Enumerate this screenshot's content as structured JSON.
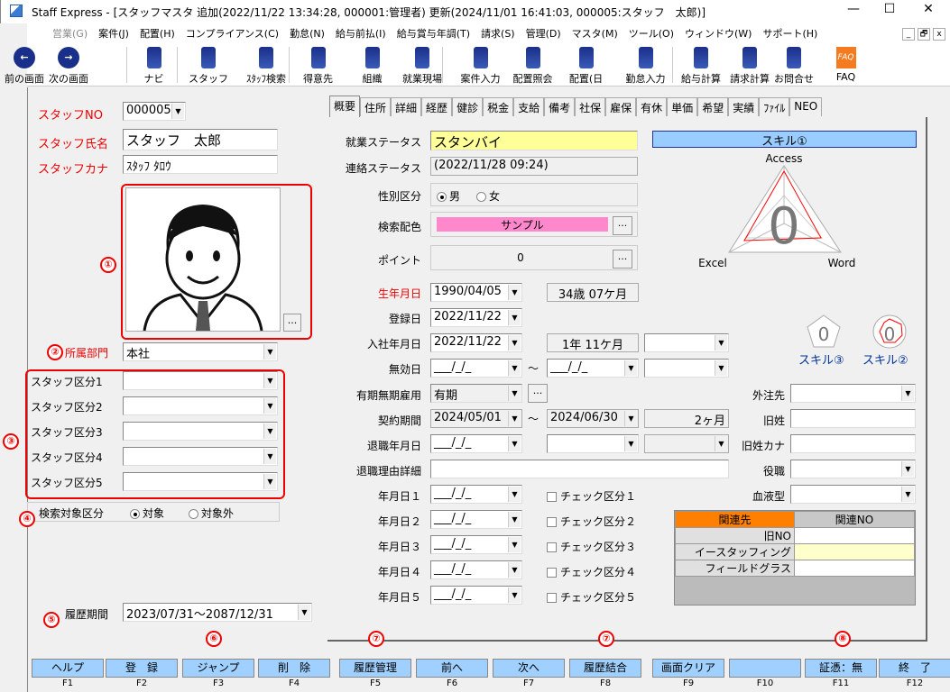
{
  "window": {
    "title": "Staff Express - [スタッフマスタ 追加(2022/11/22 13:34:28, 000001:管理者) 更新(2024/11/01 16:41:03, 000005:スタッフ　太郎)]",
    "minimize": "—",
    "maximize": "☐",
    "close": "✕"
  },
  "menu": [
    {
      "label": "営業(G)",
      "disabled": true
    },
    {
      "label": "案件(J)"
    },
    {
      "label": "配置(H)"
    },
    {
      "label": "コンプライアンス(C)"
    },
    {
      "label": "勤怠(N)"
    },
    {
      "label": "給与前払(I)"
    },
    {
      "label": "給与賞与年調(T)"
    },
    {
      "label": "請求(S)"
    },
    {
      "label": "管理(D)"
    },
    {
      "label": "マスタ(M)"
    },
    {
      "label": "ツール(O)"
    },
    {
      "label": "ウィンドウ(W)"
    },
    {
      "label": "サポート(H)"
    }
  ],
  "mdi": [
    "_",
    "🗗",
    "x"
  ],
  "toolbar": [
    {
      "label": "前の画面",
      "icon": "back-arrow-icon"
    },
    {
      "label": "次の画面",
      "icon": "forward-arrow-icon"
    },
    {
      "label": "ナビ",
      "icon": "navi-icon"
    },
    {
      "label": "スタッフ",
      "icon": "staff-icon"
    },
    {
      "label": "ｽﾀｯﾌ検索",
      "icon": "staff-search-icon"
    },
    {
      "label": "得意先",
      "icon": "customer-icon"
    },
    {
      "label": "組織",
      "icon": "organization-icon"
    },
    {
      "label": "就業現場",
      "icon": "worksite-icon"
    },
    {
      "label": "案件入力",
      "icon": "job-entry-icon"
    },
    {
      "label": "配置照会",
      "icon": "placement-query-icon"
    },
    {
      "label": "配置(日",
      "icon": "placement-daily-icon"
    },
    {
      "label": "勤怠入力",
      "icon": "attendance-entry-icon"
    },
    {
      "label": "給与計算",
      "icon": "payroll-icon"
    },
    {
      "label": "請求計算",
      "icon": "billing-icon"
    },
    {
      "label": "お問合せ",
      "icon": "inquiry-icon"
    },
    {
      "label": "FAQ",
      "icon": "faq-icon"
    }
  ],
  "left": {
    "staff_no_label": "スタッフNO",
    "staff_no": "000005",
    "staff_name_label": "スタッフ氏名",
    "staff_name": "スタッフ　太郎",
    "staff_kana_label": "スタッフカナ",
    "staff_kana": "ｽﾀｯﾌ ﾀﾛｳ",
    "photo_btn": "...",
    "dept_label": "所属部門",
    "dept": "本社",
    "categories": [
      {
        "label": "スタッフ区分1",
        "value": ""
      },
      {
        "label": "スタッフ区分2",
        "value": ""
      },
      {
        "label": "スタッフ区分3",
        "value": ""
      },
      {
        "label": "スタッフ区分4",
        "value": ""
      },
      {
        "label": "スタッフ区分5",
        "value": ""
      }
    ],
    "search_label": "検索対象区分",
    "search_opt1": "対象",
    "search_opt2": "対象外",
    "history_label": "履歴期間",
    "history": "2023/07/31～2087/12/31"
  },
  "tabs": [
    "概要",
    "住所",
    "詳細",
    "経歴",
    "健診",
    "税金",
    "支給",
    "備考",
    "社保",
    "雇保",
    "有休",
    "単価",
    "希望",
    "実績",
    "ﾌｧｲﾙ",
    "NEO"
  ],
  "form": {
    "work_status_label": "就業ステータス",
    "work_status": "スタンバイ",
    "contact_status_label": "連絡ステータス",
    "contact_status": "(2022/11/28 09:24)",
    "gender_label": "性別区分",
    "male": "男",
    "female": "女",
    "color_label": "検索配色",
    "color_value": "サンプル",
    "color_hex": "#ff88cc",
    "point_label": "ポイント",
    "point": "0",
    "birth_label": "生年月日",
    "birth": "1990/04/05",
    "age": "34歳 07ケ月",
    "reg_label": "登録日",
    "reg": "2022/11/22",
    "join_label": "入社年月日",
    "join": "2022/11/22",
    "tenure": "1年 11ケ月",
    "invalid_label": "無効日",
    "empty_date": "___/_/_",
    "term_label": "有期無期雇用",
    "term": "有期",
    "contract_label": "契約期間",
    "contract_from": "2024/05/01",
    "contract_to": "2024/06/30",
    "contract_len": "2ヶ月",
    "retire_label": "退職年月日",
    "retire_reason_label": "退職理由詳細",
    "tilde": "～",
    "dates": [
      {
        "label": "年月日１",
        "check": "チェック区分１"
      },
      {
        "label": "年月日２",
        "check": "チェック区分２"
      },
      {
        "label": "年月日３",
        "check": "チェック区分３"
      },
      {
        "label": "年月日４",
        "check": "チェック区分４"
      },
      {
        "label": "年月日５",
        "check": "チェック区分５"
      }
    ],
    "outsource_label": "外注先",
    "old_name_label": "旧姓",
    "old_kana_label": "旧姓カナ",
    "position_label": "役職",
    "blood_label": "血液型"
  },
  "skill": {
    "header": "スキル①",
    "axes": [
      "Access",
      "Word",
      "Excel"
    ],
    "center_value": "0",
    "skill3": "スキル③",
    "skill2": "スキル②"
  },
  "related": {
    "col1": "関連先",
    "col2": "関連NO",
    "rows": [
      {
        "name": "旧NO",
        "value": ""
      },
      {
        "name": "イースタッフィング",
        "value": ""
      },
      {
        "name": "フィールドグラス",
        "value": ""
      }
    ]
  },
  "fkeys": [
    {
      "label": "ヘルプ",
      "key": "F1"
    },
    {
      "label": "登　録",
      "key": "F2"
    },
    {
      "label": "ジャンプ",
      "key": "F3"
    },
    {
      "label": "削　除",
      "key": "F4"
    },
    {
      "label": "履歴管理",
      "key": "F5"
    },
    {
      "label": "前へ",
      "key": "F6"
    },
    {
      "label": "次へ",
      "key": "F7"
    },
    {
      "label": "履歴結合",
      "key": "F8"
    },
    {
      "label": "画面クリア",
      "key": "F9"
    },
    {
      "label": "",
      "key": "F10"
    },
    {
      "label": "証憑：無",
      "key": "F11"
    },
    {
      "label": "終　了",
      "key": "F12"
    }
  ],
  "annotations": [
    "①",
    "②",
    "③",
    "④",
    "⑤",
    "⑥",
    "⑦",
    "⑦",
    "⑧"
  ],
  "colors": {
    "fkey": "#9fd0ff",
    "label_red": "#e00000",
    "status_yellow": "#ffff99",
    "skill_header": "#99ccff",
    "related_header": "#ff8000"
  }
}
